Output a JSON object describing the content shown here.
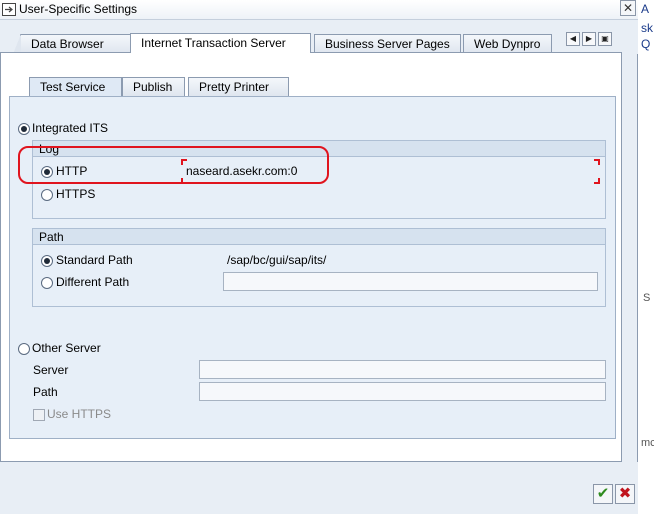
{
  "window": {
    "title": "User-Specific Settings",
    "close_glyph": "✕"
  },
  "outer_tabs": [
    {
      "label": "Data Browser"
    },
    {
      "label": "Internet Transaction Server"
    },
    {
      "label": "Business Server Pages"
    },
    {
      "label": "Web Dynpro"
    }
  ],
  "tab_nav": {
    "prev": "◀",
    "next": "▶",
    "list": "▣"
  },
  "inner_tabs": [
    {
      "label": "Test Service"
    },
    {
      "label": "Publish"
    },
    {
      "label": "Pretty Printer"
    }
  ],
  "integrated_its": {
    "label": "Integrated ITS",
    "selected": true
  },
  "log_group": {
    "title": "Log",
    "http_label": "HTTP",
    "http_value": "naseard.asekr.com:0",
    "https_label": "HTTPS",
    "selected": "HTTP"
  },
  "path_group": {
    "title": "Path",
    "standard_label": "Standard Path",
    "standard_value": "/sap/bc/gui/sap/its/",
    "different_label": "Different Path",
    "different_value": "",
    "selected": "Standard Path"
  },
  "other_server": {
    "label": "Other Server",
    "server_label": "Server",
    "server_value": "",
    "path_label": "Path",
    "path_value": "",
    "use_https_label": "Use HTTPS"
  },
  "footer": {
    "ok_glyph": "✔",
    "cancel_glyph": "✖"
  },
  "background_fragments": [
    "A",
    "sk",
    "Q",
    "S",
    "mc"
  ],
  "colors": {
    "accent_red": "#e0141e",
    "ok_green": "#2e8b1e",
    "cancel_red": "#c0141e"
  }
}
